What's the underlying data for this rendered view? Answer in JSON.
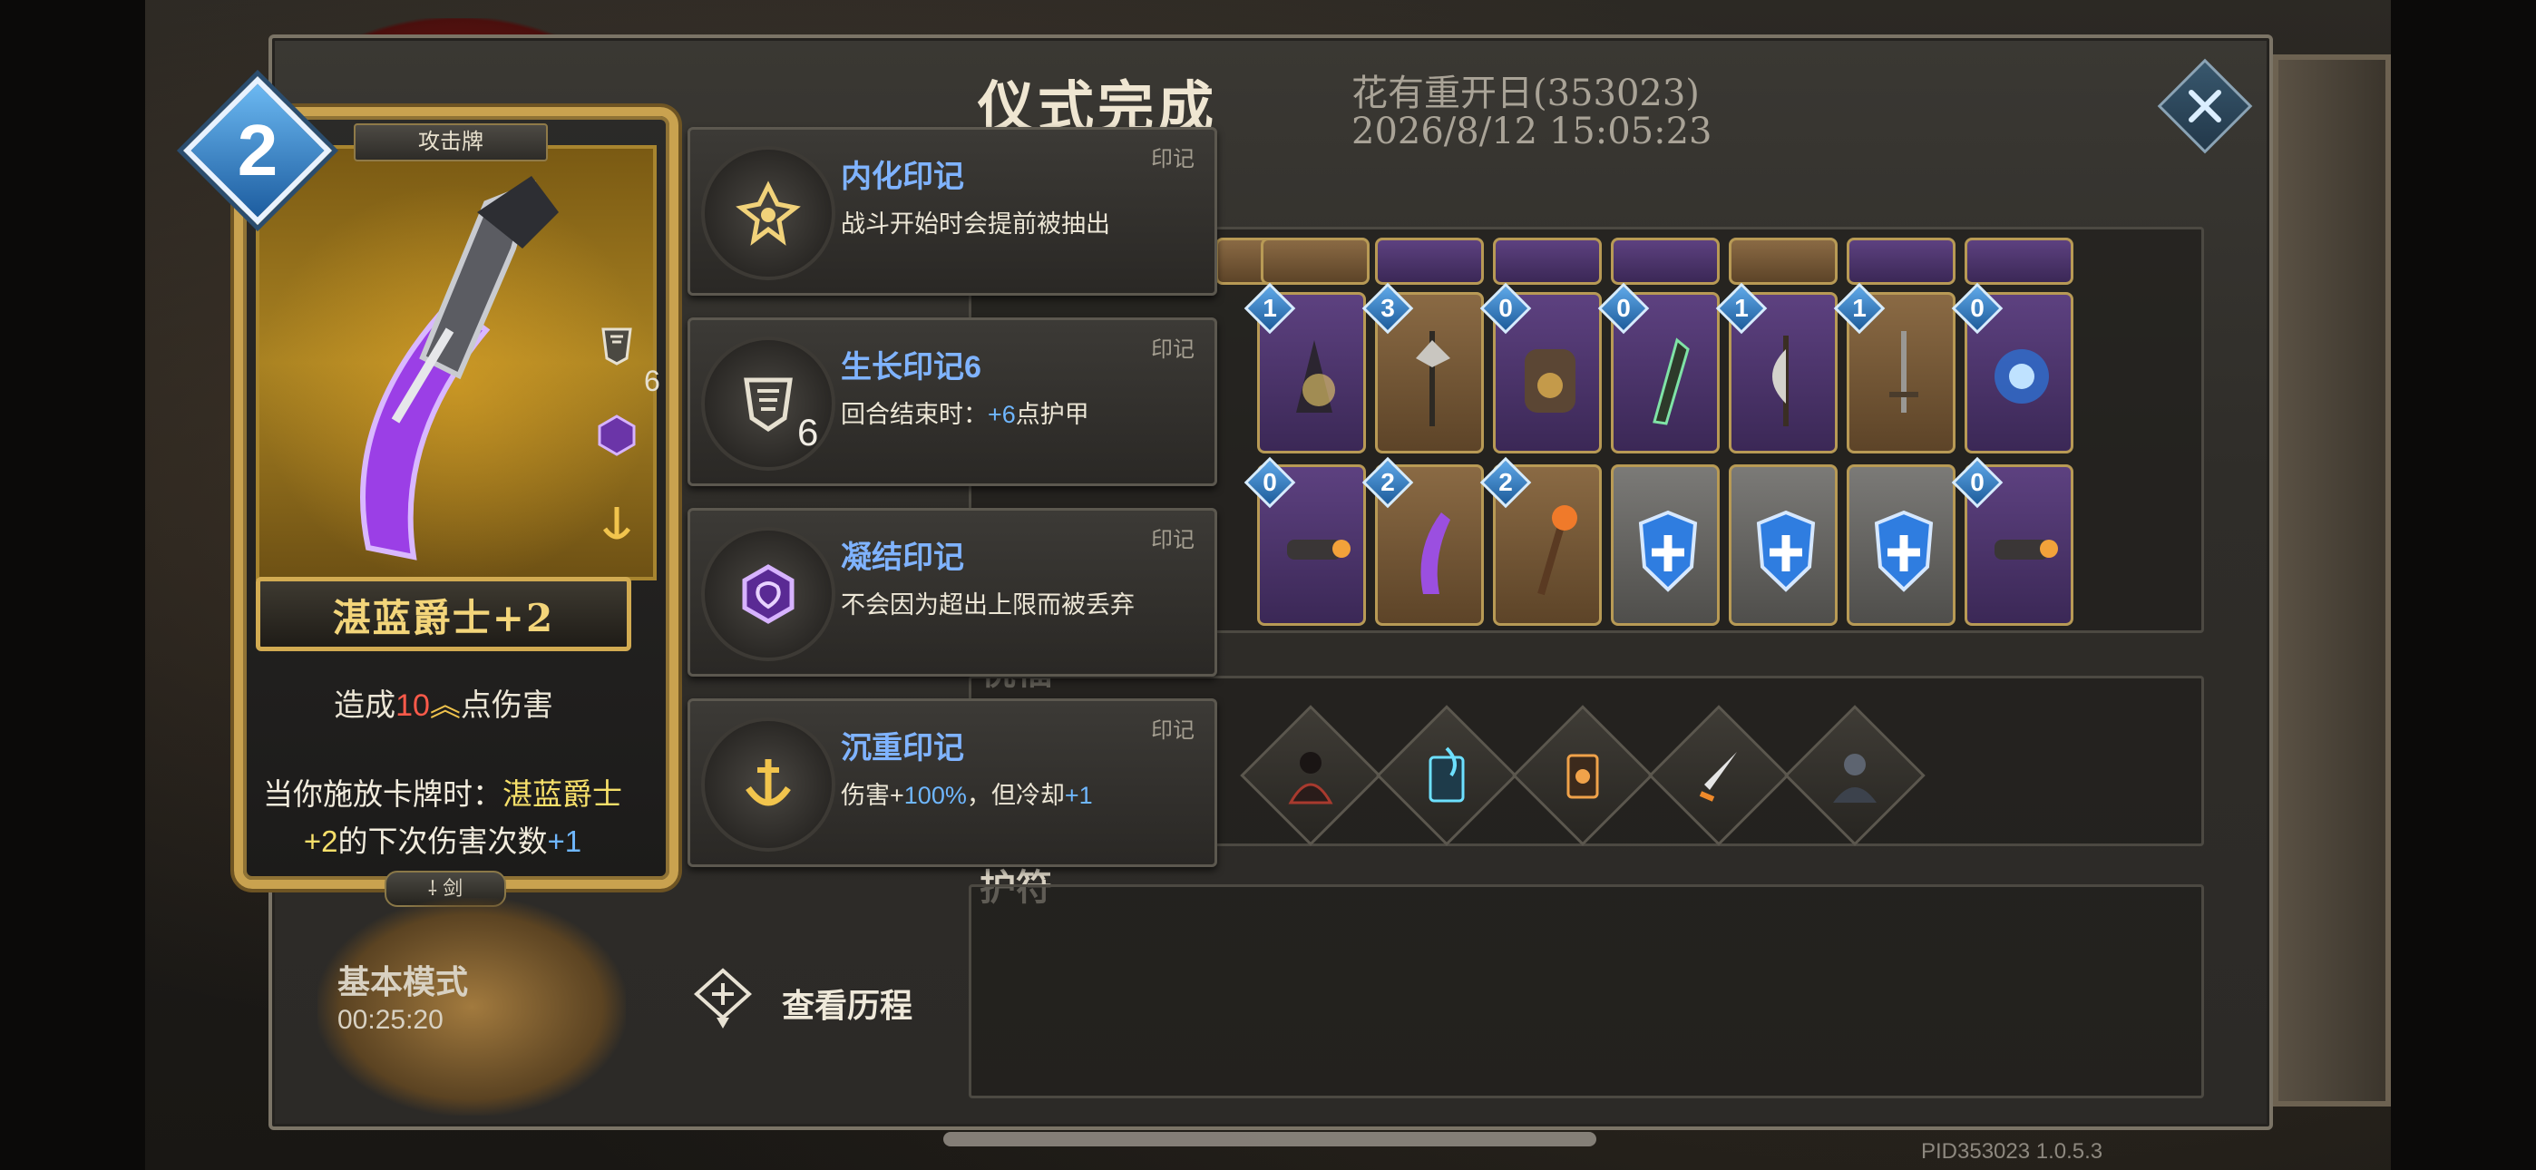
{
  "result": {
    "title": "仪式完成",
    "player": "花有重开日(353023)",
    "timestamp": "2026/8/12 15:05:23",
    "close_icon": "close-icon"
  },
  "sections": {
    "blessing_label": "祝福",
    "amulet_label": "护符"
  },
  "card": {
    "cost": "2",
    "type": "攻击牌",
    "name": "湛蓝爵士+2",
    "damage_prefix": "造成",
    "damage_value": "10",
    "damage_suffix": "点伤害",
    "effect_part1": "当你施放卡牌时：",
    "effect_highlight": "湛蓝爵士",
    "effect_part2": "+2",
    "effect_part3": "的下次伤害次数",
    "effect_bonus": "+1",
    "tag": "剑",
    "growth_stack": "6"
  },
  "marks": [
    {
      "title": "内化印记",
      "tag": "印记",
      "desc": "战斗开始时会提前被抽出",
      "icon": "internalize-mark-icon"
    },
    {
      "title": "生长印记6",
      "tag": "印记",
      "desc_pre": "回合结束时：",
      "desc_value": "+6",
      "desc_post": "点护甲",
      "stack": "6",
      "icon": "growth-mark-icon"
    },
    {
      "title": "凝结印记",
      "tag": "印记",
      "desc": "不会因为超出上限而被丢弃",
      "icon": "condense-mark-icon"
    },
    {
      "title": "沉重印记",
      "tag": "印记",
      "desc_pre": "伤害+",
      "desc_value": "100%",
      "desc_mid": "，但冷却",
      "desc_value2": "+1",
      "icon": "heavy-mark-icon"
    }
  ],
  "deck": {
    "row2_costs": [
      "1",
      "3",
      "0",
      "0",
      "1",
      "1",
      "0"
    ],
    "row3_costs": [
      "0",
      "2",
      "2",
      "0"
    ]
  },
  "footer": {
    "mode": "基本模式",
    "timer": "00:25:20",
    "history": "查看历程",
    "version": "PID353023  1.0.5.3"
  },
  "colors": {
    "mark_title": "#7fb3ff",
    "highlight_blue": "#6fb7ff",
    "damage_red": "#ff5a4a",
    "card_gold": "#c9a24f"
  }
}
